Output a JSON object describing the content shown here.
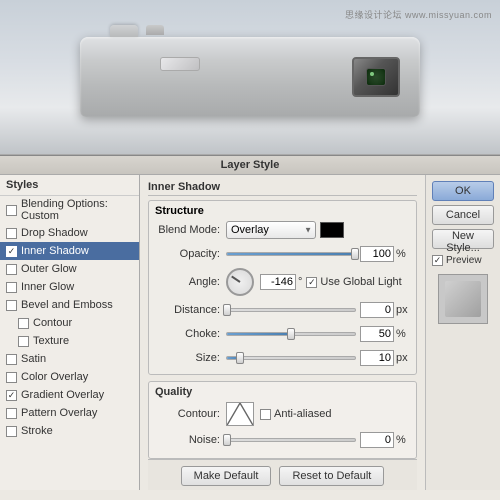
{
  "watermark": "思缘设计论坛  www.missyuan.com",
  "camera": {
    "alt": "Silver compact camera side view"
  },
  "dialog": {
    "title": "Layer Style",
    "styles_panel": {
      "title": "Styles",
      "items": [
        {
          "id": "blending-options",
          "label": "Blending Options: Custom",
          "checked": false,
          "selected": false,
          "indented": false
        },
        {
          "id": "drop-shadow",
          "label": "Drop Shadow",
          "checked": false,
          "selected": false,
          "indented": false
        },
        {
          "id": "inner-shadow",
          "label": "Inner Shadow",
          "checked": true,
          "selected": true,
          "indented": false
        },
        {
          "id": "outer-glow",
          "label": "Outer Glow",
          "checked": false,
          "selected": false,
          "indented": false
        },
        {
          "id": "inner-glow",
          "label": "Inner Glow",
          "checked": false,
          "selected": false,
          "indented": false
        },
        {
          "id": "bevel-emboss",
          "label": "Bevel and Emboss",
          "checked": false,
          "selected": false,
          "indented": false
        },
        {
          "id": "contour",
          "label": "Contour",
          "checked": false,
          "selected": false,
          "indented": true
        },
        {
          "id": "texture",
          "label": "Texture",
          "checked": false,
          "selected": false,
          "indented": true
        },
        {
          "id": "satin",
          "label": "Satin",
          "checked": false,
          "selected": false,
          "indented": false
        },
        {
          "id": "color-overlay",
          "label": "Color Overlay",
          "checked": false,
          "selected": false,
          "indented": false
        },
        {
          "id": "gradient-overlay",
          "label": "Gradient Overlay",
          "checked": true,
          "selected": false,
          "indented": false
        },
        {
          "id": "pattern-overlay",
          "label": "Pattern Overlay",
          "checked": false,
          "selected": false,
          "indented": false
        },
        {
          "id": "stroke",
          "label": "Stroke",
          "checked": false,
          "selected": false,
          "indented": false
        }
      ]
    },
    "inner_shadow": {
      "section_title": "Inner Shadow",
      "structure_title": "Structure",
      "blend_mode_label": "Blend Mode:",
      "blend_mode_value": "Overlay",
      "opacity_label": "Opacity:",
      "opacity_value": "100",
      "opacity_unit": "%",
      "angle_label": "Angle:",
      "angle_value": "-146",
      "angle_unit": "°",
      "use_global_light_label": "Use Global Light",
      "use_global_light_checked": true,
      "distance_label": "Distance:",
      "distance_value": "0",
      "distance_unit": "px",
      "choke_label": "Choke:",
      "choke_value": "50",
      "choke_unit": "%",
      "size_label": "Size:",
      "size_value": "10",
      "size_unit": "px",
      "quality_title": "Quality",
      "contour_label": "Contour:",
      "anti_aliased_label": "Anti-aliased",
      "anti_aliased_checked": false,
      "noise_label": "Noise:",
      "noise_value": "0",
      "noise_unit": "%"
    },
    "buttons": {
      "make_default": "Make Default",
      "reset_to_default": "Reset to Default",
      "ok": "OK",
      "cancel": "Cancel",
      "new_style": "New Style...",
      "preview_label": "Preview"
    }
  }
}
